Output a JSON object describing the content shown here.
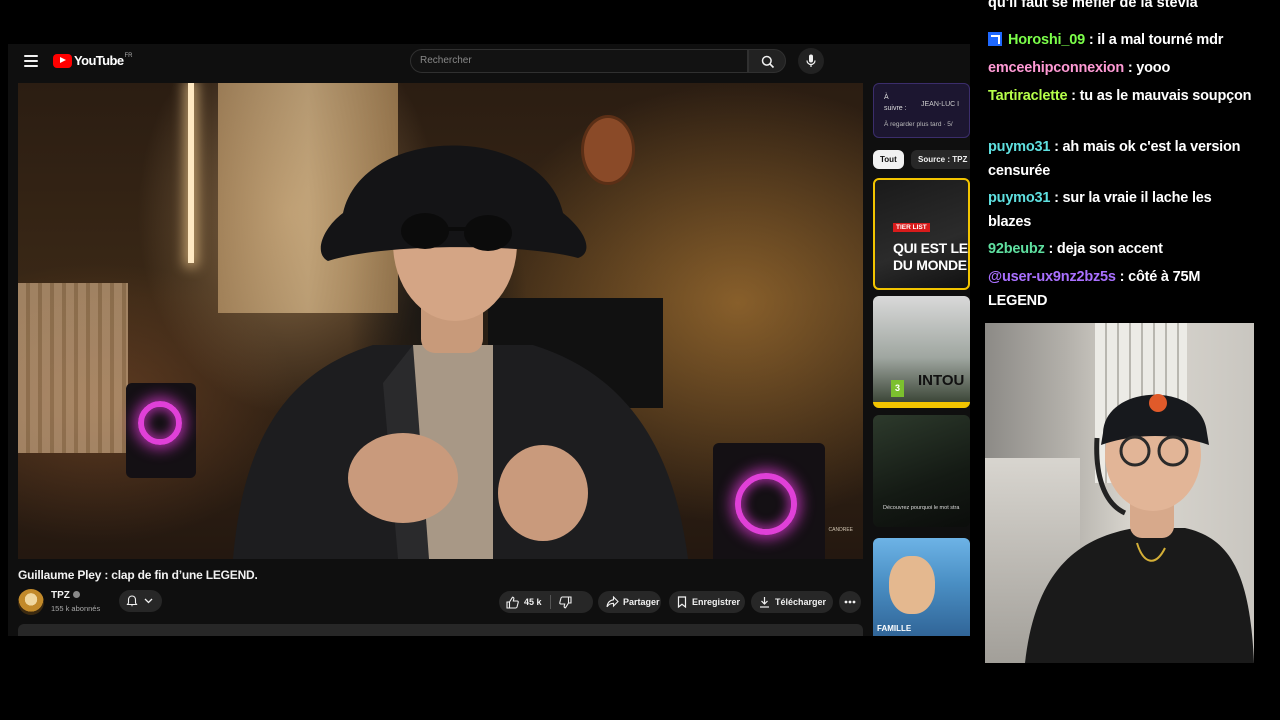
{
  "youtube": {
    "logo_text": "YouTube",
    "logo_region": "FR",
    "search_placeholder": "Rechercher",
    "video": {
      "title": "Guillaume Pley : clap de fin d’une LEGEND.",
      "watermark": "CANDREE",
      "channel": "TPZ",
      "subscribers": "155 k abonnés",
      "likes": "45 k",
      "share_label": "Partager",
      "save_label": "Enregistrer",
      "download_label": "Télécharger"
    },
    "up_next": {
      "label_a": "À",
      "label_b": "suivre :",
      "title": "JEAN-LUC I",
      "subtitle": "À regarder plus tard · 5/"
    },
    "chips": [
      "Tout",
      "Source : TPZ"
    ],
    "thumbnails": [
      {
        "badge": "TIER LIST",
        "line1": "QUI EST LE MI",
        "line2": "DU MONDE"
      },
      {
        "pegi": "3",
        "text": "INTOU"
      },
      {
        "caption": "Découvrez pourquoi le mot stra"
      },
      {
        "text": "FAMILLE"
      }
    ]
  },
  "chat": {
    "partial_line": "qu'il faut se méfier de la stevia",
    "messages": [
      {
        "user": "Horoshi_09",
        "color": "#7cff4a",
        "text": " : il a mal tourné mdr",
        "badge": "prime"
      },
      {
        "user": "emceehipconnexion",
        "color": "#ff9ad5",
        "text": " : yooo"
      },
      {
        "user": "Tartiraclette",
        "color": "#b6ff4a",
        "text": " : tu as le mauvais soupçon"
      },
      {
        "user": "puymo31",
        "color": "#5fe0e0",
        "text": " : ah mais ok c'est la version censurée"
      },
      {
        "user": "puymo31",
        "color": "#5fe0e0",
        "text": " : sur la vraie il lache les blazes"
      },
      {
        "user": "92beubz",
        "color": "#5fe0a0",
        "text": " : deja son accent"
      },
      {
        "user": "@user-ux9nz2bz5s",
        "color": "#a970ff",
        "text": " : côté à 75M LEGEND"
      }
    ]
  }
}
